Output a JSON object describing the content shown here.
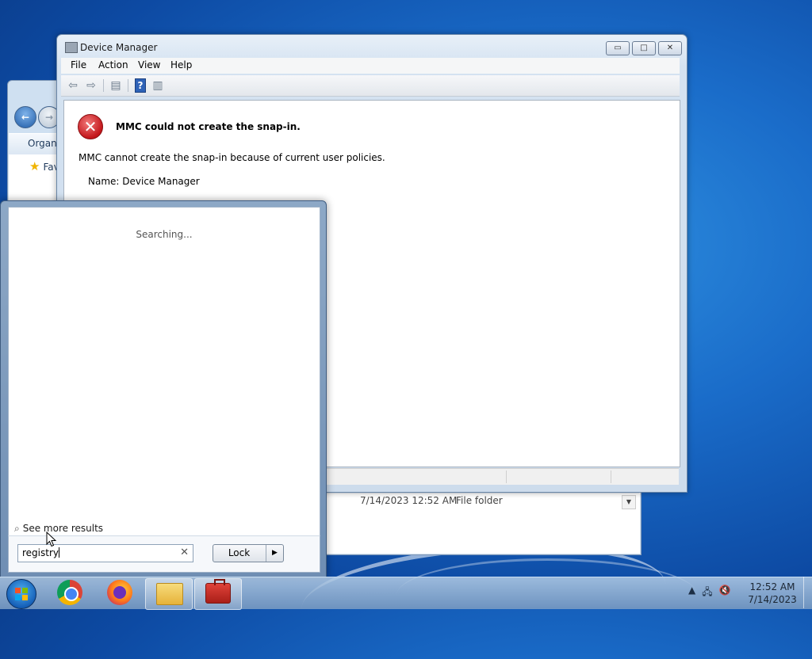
{
  "device_manager": {
    "title": "Device Manager",
    "window_buttons": {
      "minimize": "▭",
      "maximize": "□",
      "close": "✕"
    },
    "menu": [
      "File",
      "Action",
      "View",
      "Help"
    ],
    "error_title": "MMC could not create the snap-in.",
    "error_message": "MMC cannot create the snap-in because of current user policies.",
    "error_name": "Name: Device Manager"
  },
  "explorer": {
    "organize_label": "Organi",
    "favorites_label": "Fav",
    "row": {
      "date": "7/14/2023 12:52 AM",
      "type": "File folder"
    }
  },
  "start_menu": {
    "searching_text": "Searching...",
    "see_more_label": "See more results",
    "search_value": "registry",
    "lock_label": "Lock"
  },
  "taskbar": {
    "time": "12:52 AM",
    "date": "7/14/2023",
    "apps": [
      "Google Chrome",
      "Firefox",
      "Windows Explorer",
      "Computer Management"
    ]
  },
  "colors": {
    "error_red": "#c3161b",
    "desktop_blue": "#1a6cc9"
  }
}
